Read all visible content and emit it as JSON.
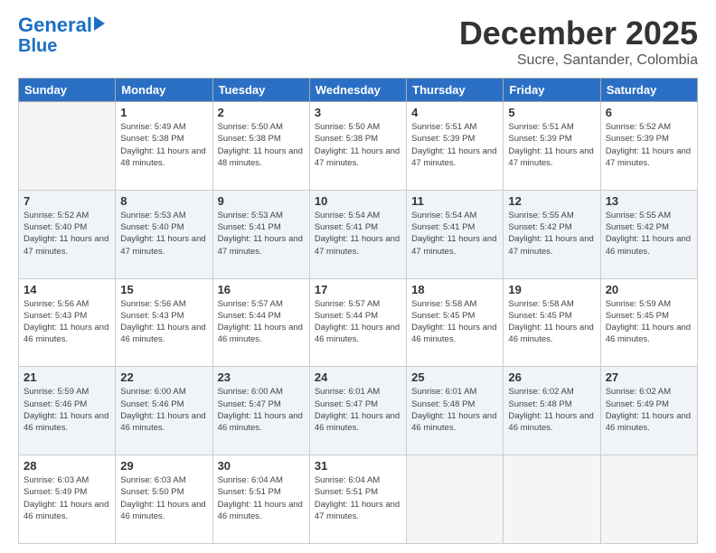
{
  "header": {
    "logo_line1": "General",
    "logo_line2": "Blue",
    "month": "December 2025",
    "location": "Sucre, Santander, Colombia"
  },
  "weekdays": [
    "Sunday",
    "Monday",
    "Tuesday",
    "Wednesday",
    "Thursday",
    "Friday",
    "Saturday"
  ],
  "weeks": [
    [
      {
        "day": "",
        "sunrise": "",
        "sunset": "",
        "daylight": ""
      },
      {
        "day": "1",
        "sunrise": "Sunrise: 5:49 AM",
        "sunset": "Sunset: 5:38 PM",
        "daylight": "Daylight: 11 hours and 48 minutes."
      },
      {
        "day": "2",
        "sunrise": "Sunrise: 5:50 AM",
        "sunset": "Sunset: 5:38 PM",
        "daylight": "Daylight: 11 hours and 48 minutes."
      },
      {
        "day": "3",
        "sunrise": "Sunrise: 5:50 AM",
        "sunset": "Sunset: 5:38 PM",
        "daylight": "Daylight: 11 hours and 47 minutes."
      },
      {
        "day": "4",
        "sunrise": "Sunrise: 5:51 AM",
        "sunset": "Sunset: 5:39 PM",
        "daylight": "Daylight: 11 hours and 47 minutes."
      },
      {
        "day": "5",
        "sunrise": "Sunrise: 5:51 AM",
        "sunset": "Sunset: 5:39 PM",
        "daylight": "Daylight: 11 hours and 47 minutes."
      },
      {
        "day": "6",
        "sunrise": "Sunrise: 5:52 AM",
        "sunset": "Sunset: 5:39 PM",
        "daylight": "Daylight: 11 hours and 47 minutes."
      }
    ],
    [
      {
        "day": "7",
        "sunrise": "Sunrise: 5:52 AM",
        "sunset": "Sunset: 5:40 PM",
        "daylight": "Daylight: 11 hours and 47 minutes."
      },
      {
        "day": "8",
        "sunrise": "Sunrise: 5:53 AM",
        "sunset": "Sunset: 5:40 PM",
        "daylight": "Daylight: 11 hours and 47 minutes."
      },
      {
        "day": "9",
        "sunrise": "Sunrise: 5:53 AM",
        "sunset": "Sunset: 5:41 PM",
        "daylight": "Daylight: 11 hours and 47 minutes."
      },
      {
        "day": "10",
        "sunrise": "Sunrise: 5:54 AM",
        "sunset": "Sunset: 5:41 PM",
        "daylight": "Daylight: 11 hours and 47 minutes."
      },
      {
        "day": "11",
        "sunrise": "Sunrise: 5:54 AM",
        "sunset": "Sunset: 5:41 PM",
        "daylight": "Daylight: 11 hours and 47 minutes."
      },
      {
        "day": "12",
        "sunrise": "Sunrise: 5:55 AM",
        "sunset": "Sunset: 5:42 PM",
        "daylight": "Daylight: 11 hours and 47 minutes."
      },
      {
        "day": "13",
        "sunrise": "Sunrise: 5:55 AM",
        "sunset": "Sunset: 5:42 PM",
        "daylight": "Daylight: 11 hours and 46 minutes."
      }
    ],
    [
      {
        "day": "14",
        "sunrise": "Sunrise: 5:56 AM",
        "sunset": "Sunset: 5:43 PM",
        "daylight": "Daylight: 11 hours and 46 minutes."
      },
      {
        "day": "15",
        "sunrise": "Sunrise: 5:56 AM",
        "sunset": "Sunset: 5:43 PM",
        "daylight": "Daylight: 11 hours and 46 minutes."
      },
      {
        "day": "16",
        "sunrise": "Sunrise: 5:57 AM",
        "sunset": "Sunset: 5:44 PM",
        "daylight": "Daylight: 11 hours and 46 minutes."
      },
      {
        "day": "17",
        "sunrise": "Sunrise: 5:57 AM",
        "sunset": "Sunset: 5:44 PM",
        "daylight": "Daylight: 11 hours and 46 minutes."
      },
      {
        "day": "18",
        "sunrise": "Sunrise: 5:58 AM",
        "sunset": "Sunset: 5:45 PM",
        "daylight": "Daylight: 11 hours and 46 minutes."
      },
      {
        "day": "19",
        "sunrise": "Sunrise: 5:58 AM",
        "sunset": "Sunset: 5:45 PM",
        "daylight": "Daylight: 11 hours and 46 minutes."
      },
      {
        "day": "20",
        "sunrise": "Sunrise: 5:59 AM",
        "sunset": "Sunset: 5:45 PM",
        "daylight": "Daylight: 11 hours and 46 minutes."
      }
    ],
    [
      {
        "day": "21",
        "sunrise": "Sunrise: 5:59 AM",
        "sunset": "Sunset: 5:46 PM",
        "daylight": "Daylight: 11 hours and 46 minutes."
      },
      {
        "day": "22",
        "sunrise": "Sunrise: 6:00 AM",
        "sunset": "Sunset: 5:46 PM",
        "daylight": "Daylight: 11 hours and 46 minutes."
      },
      {
        "day": "23",
        "sunrise": "Sunrise: 6:00 AM",
        "sunset": "Sunset: 5:47 PM",
        "daylight": "Daylight: 11 hours and 46 minutes."
      },
      {
        "day": "24",
        "sunrise": "Sunrise: 6:01 AM",
        "sunset": "Sunset: 5:47 PM",
        "daylight": "Daylight: 11 hours and 46 minutes."
      },
      {
        "day": "25",
        "sunrise": "Sunrise: 6:01 AM",
        "sunset": "Sunset: 5:48 PM",
        "daylight": "Daylight: 11 hours and 46 minutes."
      },
      {
        "day": "26",
        "sunrise": "Sunrise: 6:02 AM",
        "sunset": "Sunset: 5:48 PM",
        "daylight": "Daylight: 11 hours and 46 minutes."
      },
      {
        "day": "27",
        "sunrise": "Sunrise: 6:02 AM",
        "sunset": "Sunset: 5:49 PM",
        "daylight": "Daylight: 11 hours and 46 minutes."
      }
    ],
    [
      {
        "day": "28",
        "sunrise": "Sunrise: 6:03 AM",
        "sunset": "Sunset: 5:49 PM",
        "daylight": "Daylight: 11 hours and 46 minutes."
      },
      {
        "day": "29",
        "sunrise": "Sunrise: 6:03 AM",
        "sunset": "Sunset: 5:50 PM",
        "daylight": "Daylight: 11 hours and 46 minutes."
      },
      {
        "day": "30",
        "sunrise": "Sunrise: 6:04 AM",
        "sunset": "Sunset: 5:51 PM",
        "daylight": "Daylight: 11 hours and 46 minutes."
      },
      {
        "day": "31",
        "sunrise": "Sunrise: 6:04 AM",
        "sunset": "Sunset: 5:51 PM",
        "daylight": "Daylight: 11 hours and 47 minutes."
      },
      {
        "day": "",
        "sunrise": "",
        "sunset": "",
        "daylight": ""
      },
      {
        "day": "",
        "sunrise": "",
        "sunset": "",
        "daylight": ""
      },
      {
        "day": "",
        "sunrise": "",
        "sunset": "",
        "daylight": ""
      }
    ]
  ]
}
